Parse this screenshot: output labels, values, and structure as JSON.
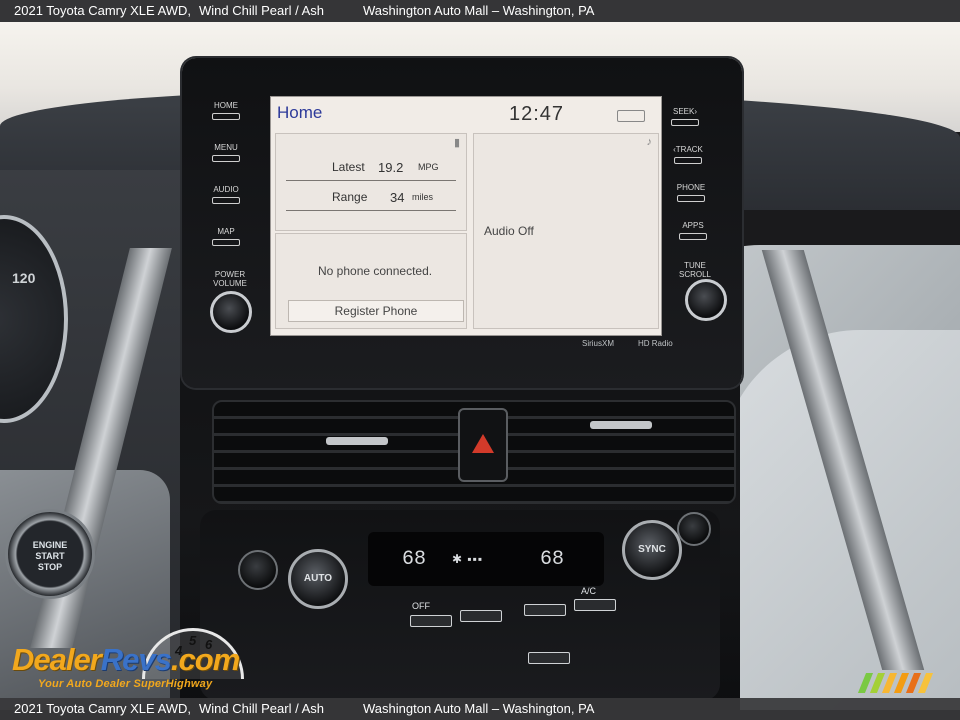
{
  "caption": {
    "title": "2021 Toyota Camry XLE AWD,",
    "trim": "Wind Chill Pearl / Ash",
    "dealer": "Washington Auto Mall – Washington, PA"
  },
  "head_unit": {
    "left_buttons": [
      "HOME",
      "MENU",
      "AUDIO",
      "MAP"
    ],
    "power_label_line1": "POWER",
    "power_label_line2": "VOLUME",
    "right_buttons": [
      "SEEK›",
      "‹TRACK",
      "PHONE",
      "APPS"
    ],
    "tune_label_line1": "TUNE",
    "tune_label_line2": "SCROLL",
    "brand_left": "SiriusXM",
    "brand_right": "HD Radio"
  },
  "screen": {
    "home_label": "Home",
    "clock": "12:47",
    "eco": {
      "latest_label": "Latest",
      "latest_value": "19.2",
      "latest_unit": "MPG",
      "range_label": "Range",
      "range_value": "34",
      "range_unit": "miles"
    },
    "audio_status": "Audio Off",
    "phone_status": "No phone connected.",
    "register_phone": "Register Phone"
  },
  "climate": {
    "left_temp": "68",
    "right_temp": "68",
    "auto_label": "AUTO",
    "sync_label": "SYNC",
    "off_label": "OFF",
    "ac_label": "A/C"
  },
  "engine_button": {
    "line1": "ENGINE",
    "line2": "START",
    "line3": "STOP"
  },
  "gauge_reading": "120",
  "watermark": {
    "brand_part1": "Dealer",
    "brand_part2": "Revs",
    "brand_part3": ".com",
    "gauge_numbers": [
      "4",
      "5",
      "6"
    ],
    "tagline": "Your Auto Dealer SuperHighway"
  },
  "colors": {
    "screen_bg": "#f1ece7",
    "home_blue": "#2d3a9a",
    "watermark_orange": "#f2a81d",
    "watermark_blue": "#3a72c8",
    "stripe_colors": [
      "#7ac943",
      "#a4d037",
      "#f7b733",
      "#f39c12",
      "#e8701a",
      "#f7c23b"
    ]
  }
}
